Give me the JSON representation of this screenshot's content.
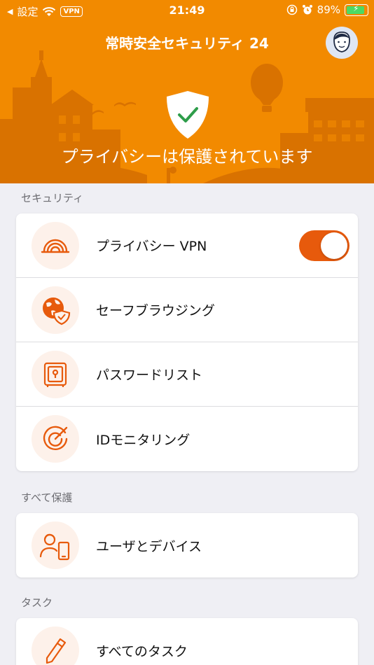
{
  "status_bar": {
    "back_label": "設定",
    "vpn_badge": "VPN",
    "time": "21:49",
    "battery": "89%",
    "battery_level": 0.89
  },
  "header": {
    "title": "常時安全セキュリティ 24",
    "status": "プライバシーは保護されています",
    "background_color": "#f28a00"
  },
  "sections": {
    "security": {
      "label": "セキュリティ",
      "items": [
        {
          "label": "プライバシー VPN",
          "icon": "vpn-signal-icon",
          "toggle_on": true
        },
        {
          "label": "セーフブラウジング",
          "icon": "globe-shield-icon"
        },
        {
          "label": "パスワードリスト",
          "icon": "safe-vault-icon"
        },
        {
          "label": "IDモニタリング",
          "icon": "radar-icon"
        }
      ]
    },
    "protect_all": {
      "label": "すべて保護",
      "items": [
        {
          "label": "ユーザとデバイス",
          "icon": "user-device-icon"
        }
      ]
    },
    "tasks": {
      "label": "タスク",
      "items": [
        {
          "label": "すべてのタスク",
          "icon": "pencil-icon"
        }
      ]
    }
  },
  "colors": {
    "accent": "#e75a0c",
    "icon_bg": "#fdf1ea",
    "check": "#2e9d4a"
  }
}
